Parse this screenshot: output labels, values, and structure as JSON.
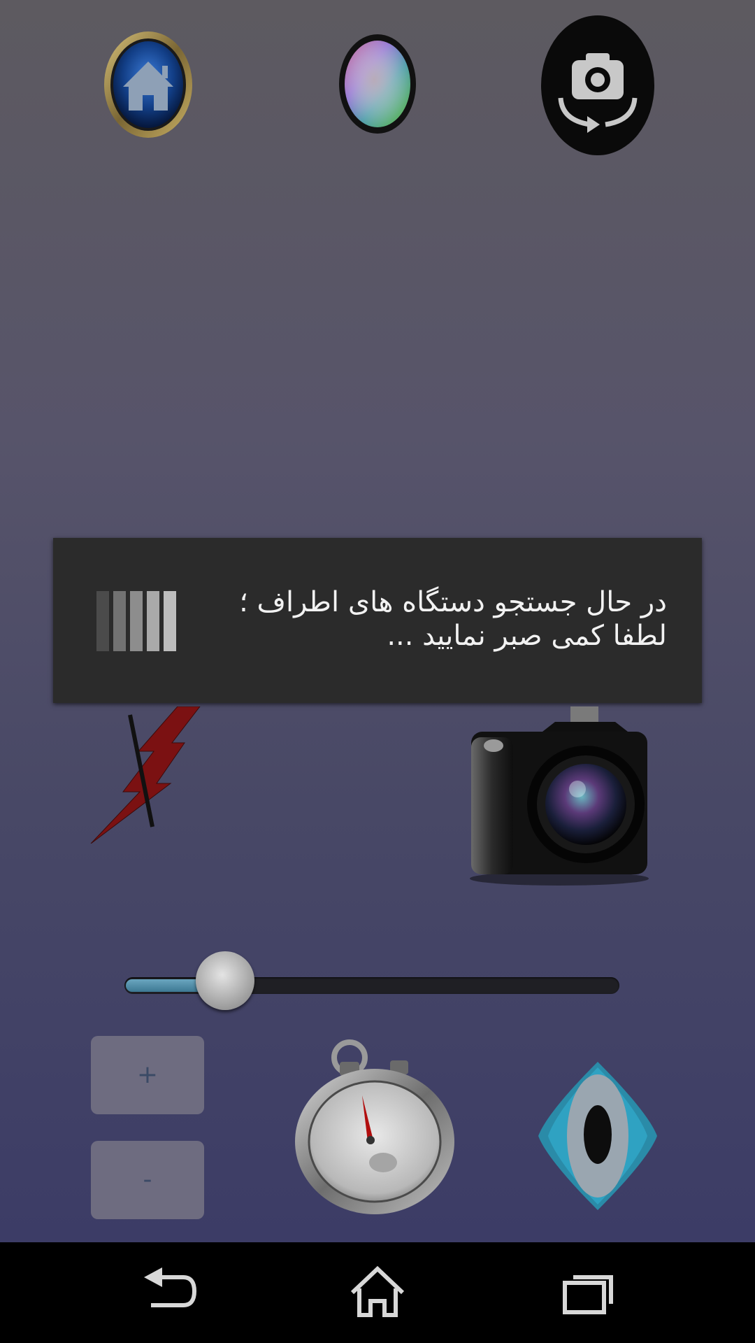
{
  "top_bar": {
    "home_icon": "home-icon",
    "color_filter_icon": "color-wheel-icon",
    "switch_camera_icon": "camera-switch-icon"
  },
  "dialog": {
    "message_line1": "در حال جستجو دستگاه های اطراف ؛",
    "message_line2": "لطفا کمی صبر نمایید ...",
    "spinner_icon": "loading-bars-icon"
  },
  "controls": {
    "flash_icon": "flash-off-icon",
    "capture_icon": "camera-icon",
    "zoom_level": 0.15,
    "zoom_in_label": "+",
    "zoom_out_label": "-",
    "timer_icon": "stopwatch-icon",
    "preview_icon": "eye-icon"
  },
  "navbar": {
    "back_icon": "back-icon",
    "home_icon": "home-outline-icon",
    "recents_icon": "recent-apps-icon"
  },
  "colors": {
    "dialog_bg": "#2b2b2b",
    "slider_fill": "#4b8aa6",
    "eye_teal": "#2aa3c0"
  }
}
